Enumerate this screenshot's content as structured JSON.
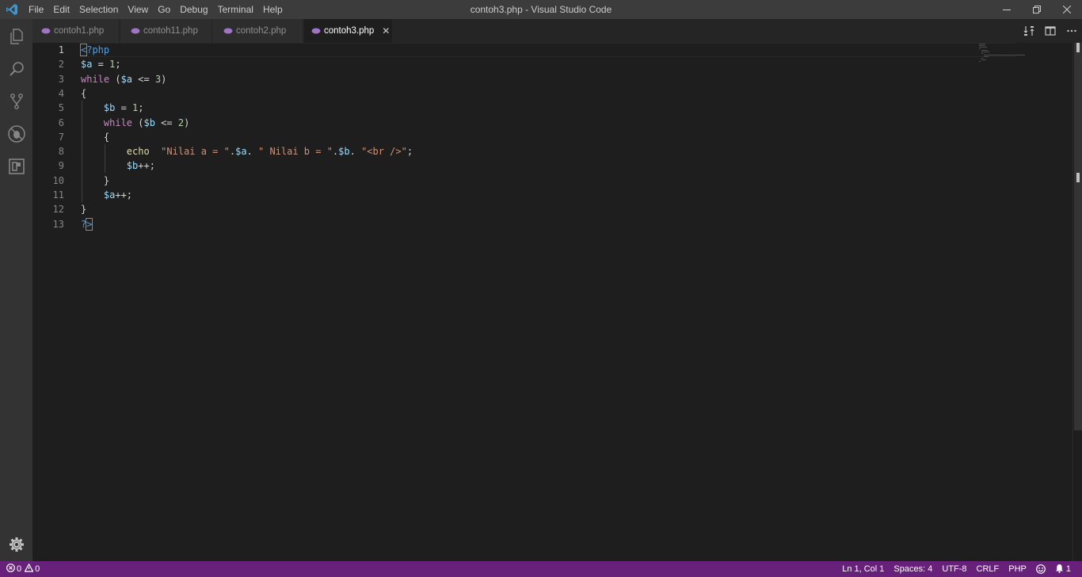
{
  "titlebar": {
    "app_icon": "vscode-logo-icon",
    "menu": [
      "File",
      "Edit",
      "Selection",
      "View",
      "Go",
      "Debug",
      "Terminal",
      "Help"
    ],
    "title": "contoh3.php - Visual Studio Code",
    "controls": [
      "minimize-icon",
      "restore-icon",
      "close-icon"
    ]
  },
  "activitybar": {
    "items": [
      "explorer-icon",
      "search-icon",
      "source-control-icon",
      "debug-icon",
      "extensions-icon"
    ],
    "bottom": "gear-icon"
  },
  "tabs": [
    {
      "label": "contoh1.php",
      "active": false,
      "icon": "php-icon"
    },
    {
      "label": "contoh11.php",
      "active": false,
      "icon": "php-icon"
    },
    {
      "label": "contoh2.php",
      "active": false,
      "icon": "php-icon"
    },
    {
      "label": "contoh3.php",
      "active": true,
      "icon": "php-icon",
      "close": "✕"
    }
  ],
  "tab_actions": [
    "open-changes-icon",
    "split-editor-icon",
    "more-actions-icon"
  ],
  "editor": {
    "active_line": 1,
    "lines": [
      {
        "n": "1",
        "tokens": [
          {
            "t": "<",
            "c": "tag",
            "box": true
          },
          {
            "t": "?php",
            "c": "tag"
          }
        ]
      },
      {
        "n": "2",
        "tokens": [
          {
            "t": "$a",
            "c": "var"
          },
          {
            "t": " = ",
            "c": "default"
          },
          {
            "t": "1",
            "c": "num"
          },
          {
            "t": ";",
            "c": "default"
          }
        ]
      },
      {
        "n": "3",
        "tokens": [
          {
            "t": "while",
            "c": "kw"
          },
          {
            "t": " (",
            "c": "default"
          },
          {
            "t": "$a",
            "c": "var"
          },
          {
            "t": " <= ",
            "c": "default"
          },
          {
            "t": "3",
            "c": "num"
          },
          {
            "t": ")",
            "c": "default"
          }
        ]
      },
      {
        "n": "4",
        "tokens": [
          {
            "t": "{",
            "c": "default"
          }
        ]
      },
      {
        "n": "5",
        "tokens": [
          {
            "t": "    ",
            "c": "default"
          },
          {
            "t": "$b",
            "c": "var"
          },
          {
            "t": " = ",
            "c": "default"
          },
          {
            "t": "1",
            "c": "num"
          },
          {
            "t": ";",
            "c": "default"
          }
        ]
      },
      {
        "n": "6",
        "tokens": [
          {
            "t": "    ",
            "c": "default"
          },
          {
            "t": "while",
            "c": "kw"
          },
          {
            "t": " (",
            "c": "default"
          },
          {
            "t": "$b",
            "c": "var"
          },
          {
            "t": " <= ",
            "c": "default"
          },
          {
            "t": "2",
            "c": "num"
          },
          {
            "t": ")",
            "c": "default"
          }
        ]
      },
      {
        "n": "7",
        "tokens": [
          {
            "t": "    ",
            "c": "default"
          },
          {
            "t": "{",
            "c": "default"
          }
        ]
      },
      {
        "n": "8",
        "tokens": [
          {
            "t": "        ",
            "c": "default"
          },
          {
            "t": "echo",
            "c": "fn"
          },
          {
            "t": "  ",
            "c": "default"
          },
          {
            "t": "\"Nilai a = \"",
            "c": "str"
          },
          {
            "t": ".",
            "c": "default"
          },
          {
            "t": "$a",
            "c": "var"
          },
          {
            "t": ". ",
            "c": "default"
          },
          {
            "t": "\" Nilai b = \"",
            "c": "str"
          },
          {
            "t": ".",
            "c": "default"
          },
          {
            "t": "$b",
            "c": "var"
          },
          {
            "t": ". ",
            "c": "default"
          },
          {
            "t": "\"<br />\"",
            "c": "str"
          },
          {
            "t": ";",
            "c": "default"
          }
        ]
      },
      {
        "n": "9",
        "tokens": [
          {
            "t": "        ",
            "c": "default"
          },
          {
            "t": "$b",
            "c": "var"
          },
          {
            "t": "++;",
            "c": "default"
          }
        ]
      },
      {
        "n": "10",
        "tokens": [
          {
            "t": "    ",
            "c": "default"
          },
          {
            "t": "}",
            "c": "default"
          }
        ]
      },
      {
        "n": "11",
        "tokens": [
          {
            "t": "    ",
            "c": "default"
          },
          {
            "t": "$a",
            "c": "var"
          },
          {
            "t": "++;",
            "c": "default"
          }
        ]
      },
      {
        "n": "12",
        "tokens": [
          {
            "t": "}",
            "c": "default"
          }
        ]
      },
      {
        "n": "13",
        "tokens": [
          {
            "t": "?",
            "c": "tag"
          },
          {
            "t": ">",
            "c": "tag",
            "box": true
          }
        ]
      }
    ]
  },
  "statusbar": {
    "errors": "0",
    "warnings": "0",
    "position": "Ln 1, Col 1",
    "indent": "Spaces: 4",
    "encoding": "UTF-8",
    "eol": "CRLF",
    "language": "PHP",
    "feedback_icon": "smiley-icon",
    "notifications": "1"
  },
  "colors": {
    "statusbar_bg": "#68217a",
    "titlebar_bg": "#3c3c3c",
    "editor_bg": "#1e1e1e"
  }
}
